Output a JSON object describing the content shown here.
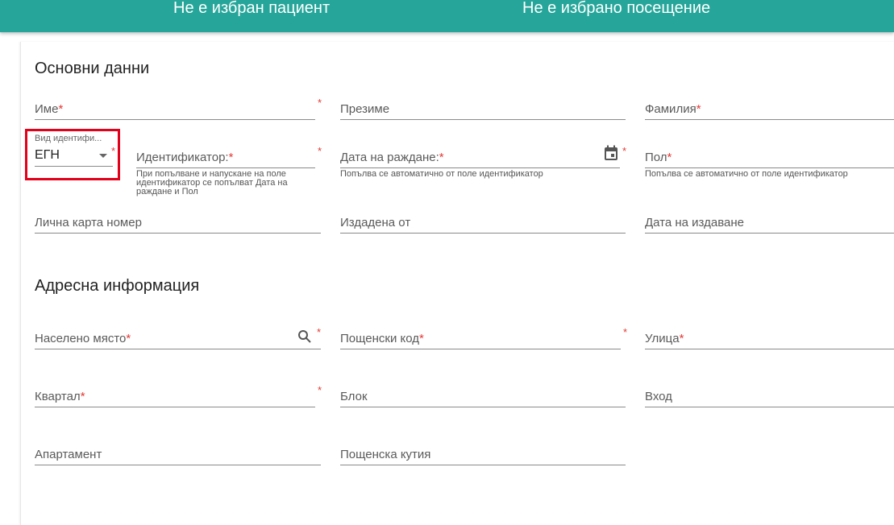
{
  "header": {
    "patient_status": "Не е избран пациент",
    "visit_status": "Не е избрано посещение",
    "color": "#26a69a"
  },
  "basic": {
    "title": "Основни данни",
    "first_name_label": "Име",
    "middle_name_label": "Презиме",
    "last_name_label": "Фамилия",
    "id_type": {
      "label": "Вид идентифи...",
      "value": "ЕГН",
      "icon": "chevron-down-icon"
    },
    "identifier_label": "Идентификатор:",
    "identifier_hint": "При попълване и напускане на поле идентификатор се попълват Дата на раждане и Пол",
    "birth_date_label": "Дата на раждане:",
    "birth_date_hint": "Попълва се автоматично от поле идентификатор",
    "birth_date_icon": "calendar-icon",
    "sex_label": "Пол",
    "sex_hint": "Попълва се автоматично от поле идентификатор",
    "id_card_label": "Лична карта номер",
    "issued_by_label": "Издадена от",
    "issue_date_label": "Дата на издаване",
    "required_mark": "*"
  },
  "address": {
    "title": "Адресна информация",
    "city_label": "Населено място",
    "city_icon": "search-icon",
    "postal_code_label": "Пощенски код",
    "street_label": "Улица",
    "district_label": "Квартал",
    "block_label": "Блок",
    "entrance_label": "Вход",
    "apartment_label": "Апартамент",
    "po_box_label": "Пощенска кутия"
  },
  "highlight_color": "#e3001b"
}
